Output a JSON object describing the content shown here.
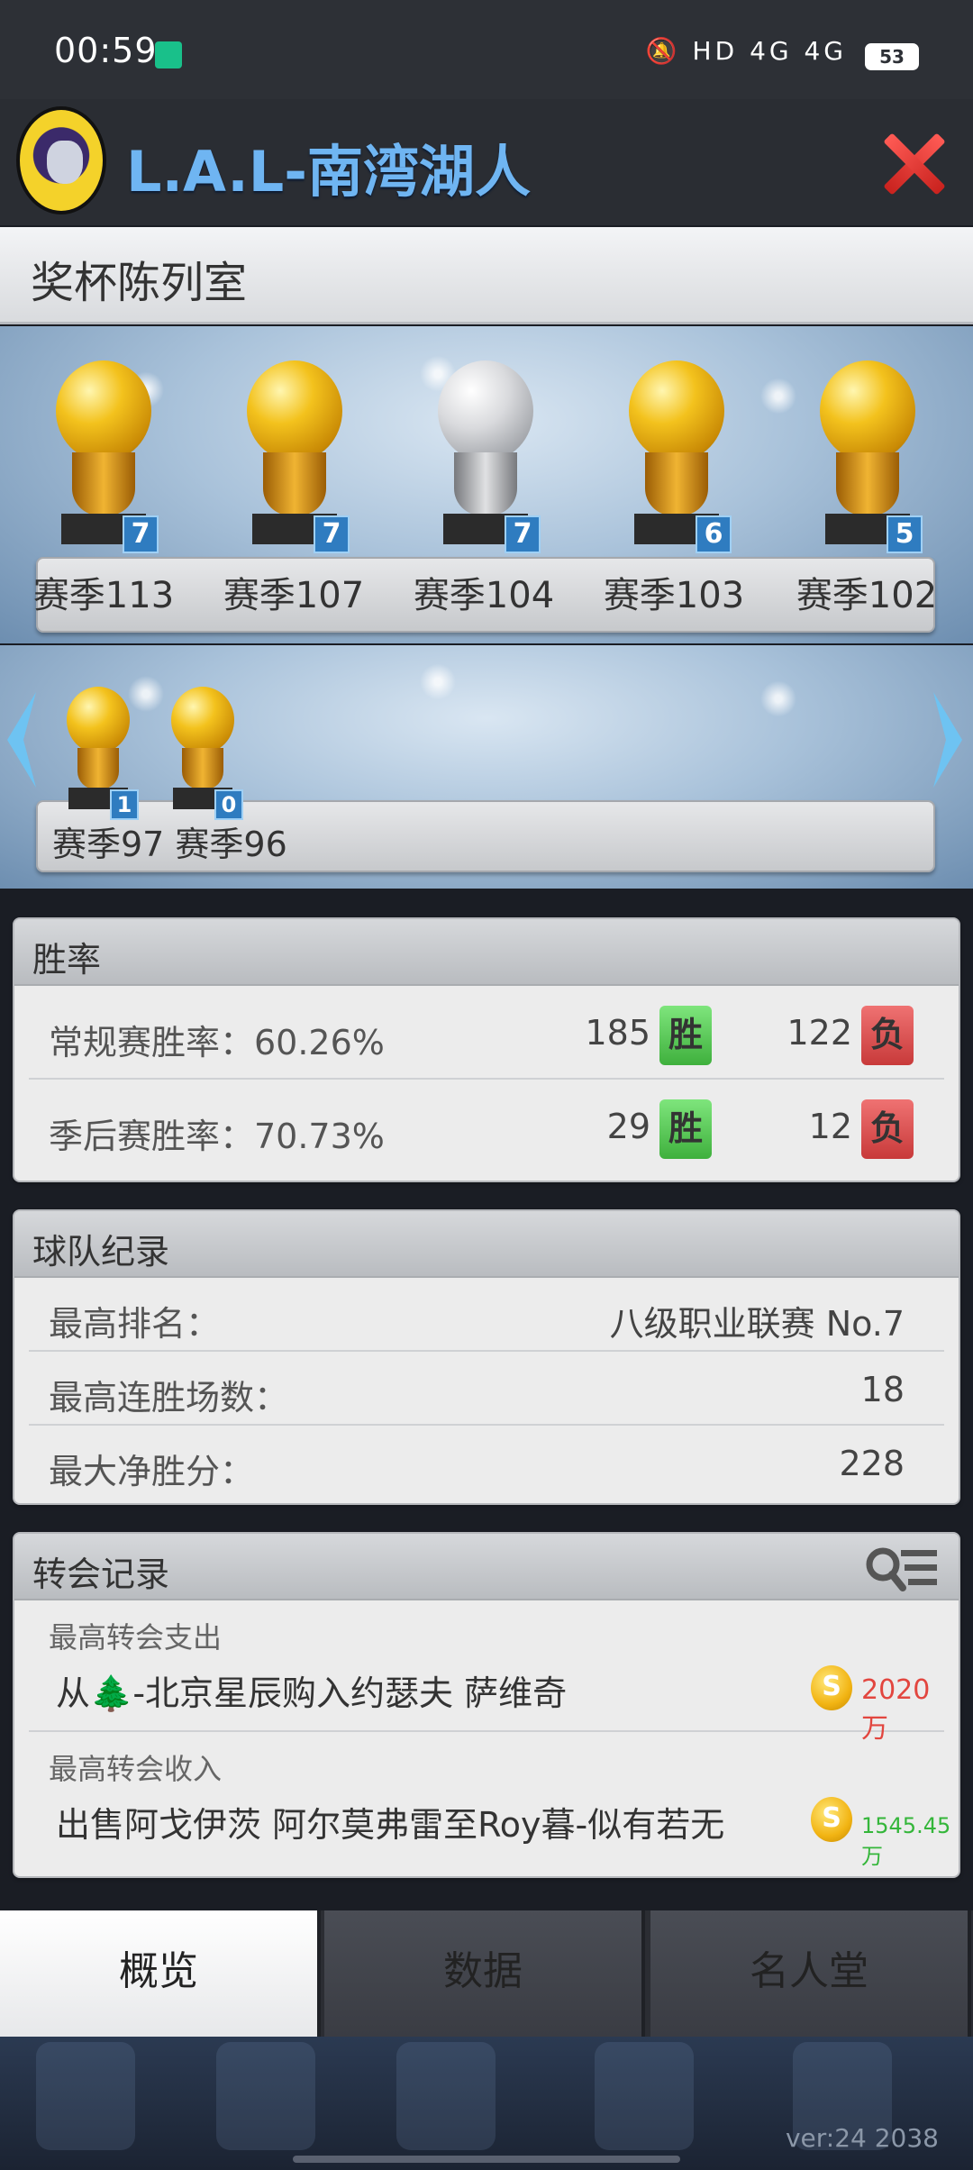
{
  "status_bar": {
    "time": "00:59",
    "sys_icons": "🔕 HD 4G 4G",
    "battery": "53"
  },
  "header": {
    "team_name": "L.A.L-南湾湖人"
  },
  "trophy_room": {
    "title": "奖杯陈列室",
    "row1": [
      {
        "season": "赛季113",
        "count": "7",
        "type": "gold"
      },
      {
        "season": "赛季107",
        "count": "7",
        "type": "gold"
      },
      {
        "season": "赛季104",
        "count": "7",
        "type": "silver"
      },
      {
        "season": "赛季103",
        "count": "6",
        "type": "gold"
      },
      {
        "season": "赛季102",
        "count": "5",
        "type": "gold"
      }
    ],
    "row2": [
      {
        "season": "赛季97",
        "count": "1",
        "type": "gold"
      },
      {
        "season": "赛季96",
        "count": "0",
        "type": "gold"
      }
    ],
    "row2_label": "赛季97 赛季96"
  },
  "win_rate": {
    "title": "胜率",
    "regular": {
      "label": "常规赛胜率：60.26%",
      "wins": "185",
      "win_tag": "胜",
      "losses": "122",
      "loss_tag": "负"
    },
    "playoff": {
      "label": "季后赛胜率：70.73%",
      "wins": "29",
      "win_tag": "胜",
      "losses": "12",
      "loss_tag": "负"
    }
  },
  "team_record": {
    "title": "球队纪录",
    "rows": [
      {
        "label": "最高排名：",
        "value": "八级职业联赛 No.7"
      },
      {
        "label": "最高连胜场数：",
        "value": "18"
      },
      {
        "label": "最大净胜分：",
        "value": "228"
      }
    ]
  },
  "transfer_record": {
    "title": "转会记录",
    "expense": {
      "sub": "最高转会支出",
      "desc": "从🌲-北京星辰购入约瑟夫 萨维奇",
      "amount": "2020万"
    },
    "income": {
      "sub": "最高转会收入",
      "desc": "出售阿戈伊茨 阿尔莫弗雷至Roy暮-似有若无",
      "amount": "1545.45万"
    },
    "coin_symbol": "S"
  },
  "tabs": {
    "overview": "概览",
    "data": "数据",
    "hall_of_fame": "名人堂"
  },
  "version": "ver:24  2038",
  "colors": {
    "team_name": "#6fb5f2",
    "win_badge": "#4fc04c",
    "loss_badge": "#d84a4a",
    "expense": "#e2463f",
    "income": "#34b63a"
  }
}
